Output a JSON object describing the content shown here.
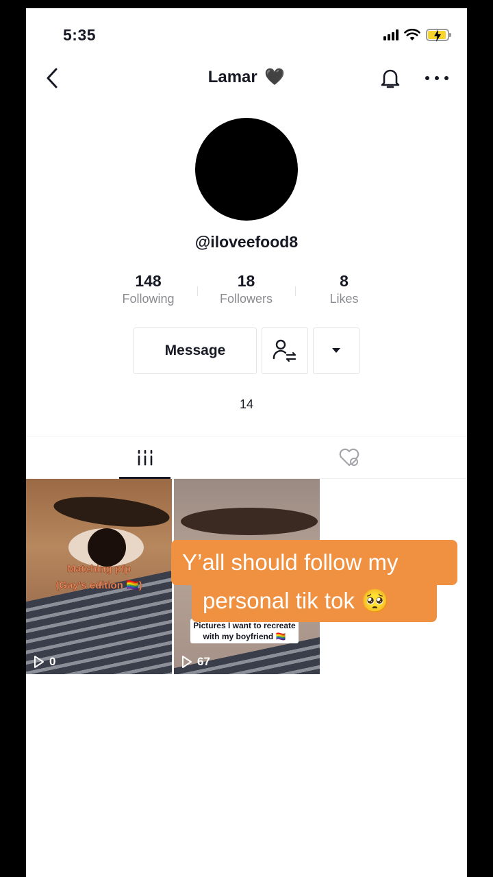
{
  "status_bar": {
    "time": "5:35"
  },
  "nav": {
    "title": "Lamar",
    "title_emoji": "🖤"
  },
  "profile": {
    "username": "@iloveefood8",
    "stats": [
      {
        "value": "148",
        "label": "Following"
      },
      {
        "value": "18",
        "label": "Followers"
      },
      {
        "value": "8",
        "label": "Likes"
      }
    ],
    "message_button": "Message",
    "bio": "14"
  },
  "videos": [
    {
      "caption": "Matching pfp\n(Gay's edition 🏳️‍🌈)",
      "views": "0"
    },
    {
      "caption": "Pictures I want to recreate with my boyfriend 🏳️‍🌈",
      "views": "67"
    }
  ],
  "overlay": {
    "line1": "Y’all should follow my",
    "line2": "personal tik tok 🥺"
  },
  "colors": {
    "accent_overlay": "#f09142",
    "battery": "#f7d42b"
  }
}
